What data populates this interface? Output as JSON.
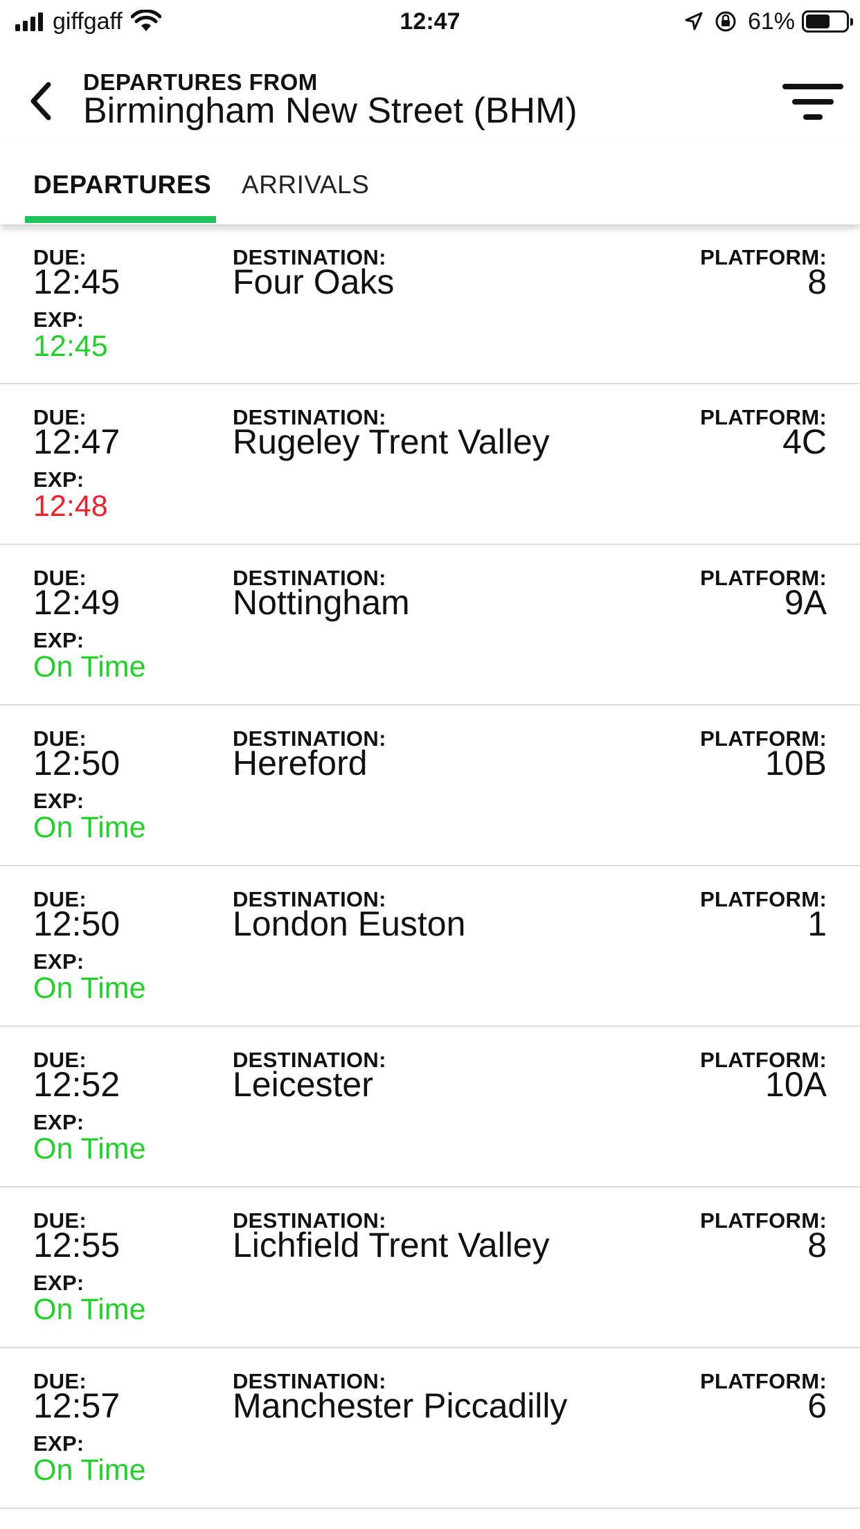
{
  "status_bar": {
    "carrier": "giffgaff",
    "time": "12:47",
    "battery_percent": "61%",
    "battery_level": 0.61
  },
  "header": {
    "subtitle": "DEPARTURES FROM",
    "title": "Birmingham New Street (BHM)"
  },
  "tabs": [
    {
      "label": "DEPARTURES",
      "active": true
    },
    {
      "label": "ARRIVALS",
      "active": false
    }
  ],
  "colors": {
    "accent": "#1ec45a",
    "on_time": "#22d02a",
    "late": "#f0202a"
  },
  "labels": {
    "due": "DUE:",
    "exp": "EXP:",
    "destination": "DESTINATION:",
    "platform": "PLATFORM:"
  },
  "departures": [
    {
      "due": "12:45",
      "expected": "12:45",
      "status": "on_time",
      "destination": "Four Oaks",
      "platform": "8"
    },
    {
      "due": "12:47",
      "expected": "12:48",
      "status": "late",
      "destination": "Rugeley Trent Valley",
      "platform": "4C"
    },
    {
      "due": "12:49",
      "expected": "On Time",
      "status": "on_time",
      "destination": "Nottingham",
      "platform": "9A"
    },
    {
      "due": "12:50",
      "expected": "On Time",
      "status": "on_time",
      "destination": "Hereford",
      "platform": "10B"
    },
    {
      "due": "12:50",
      "expected": "On Time",
      "status": "on_time",
      "destination": "London Euston",
      "platform": "1"
    },
    {
      "due": "12:52",
      "expected": "On Time",
      "status": "on_time",
      "destination": "Leicester",
      "platform": "10A"
    },
    {
      "due": "12:55",
      "expected": "On Time",
      "status": "on_time",
      "destination": "Lichfield Trent Valley",
      "platform": "8"
    },
    {
      "due": "12:57",
      "expected": "On Time",
      "status": "on_time",
      "destination": "Manchester Piccadilly",
      "platform": "6"
    }
  ]
}
